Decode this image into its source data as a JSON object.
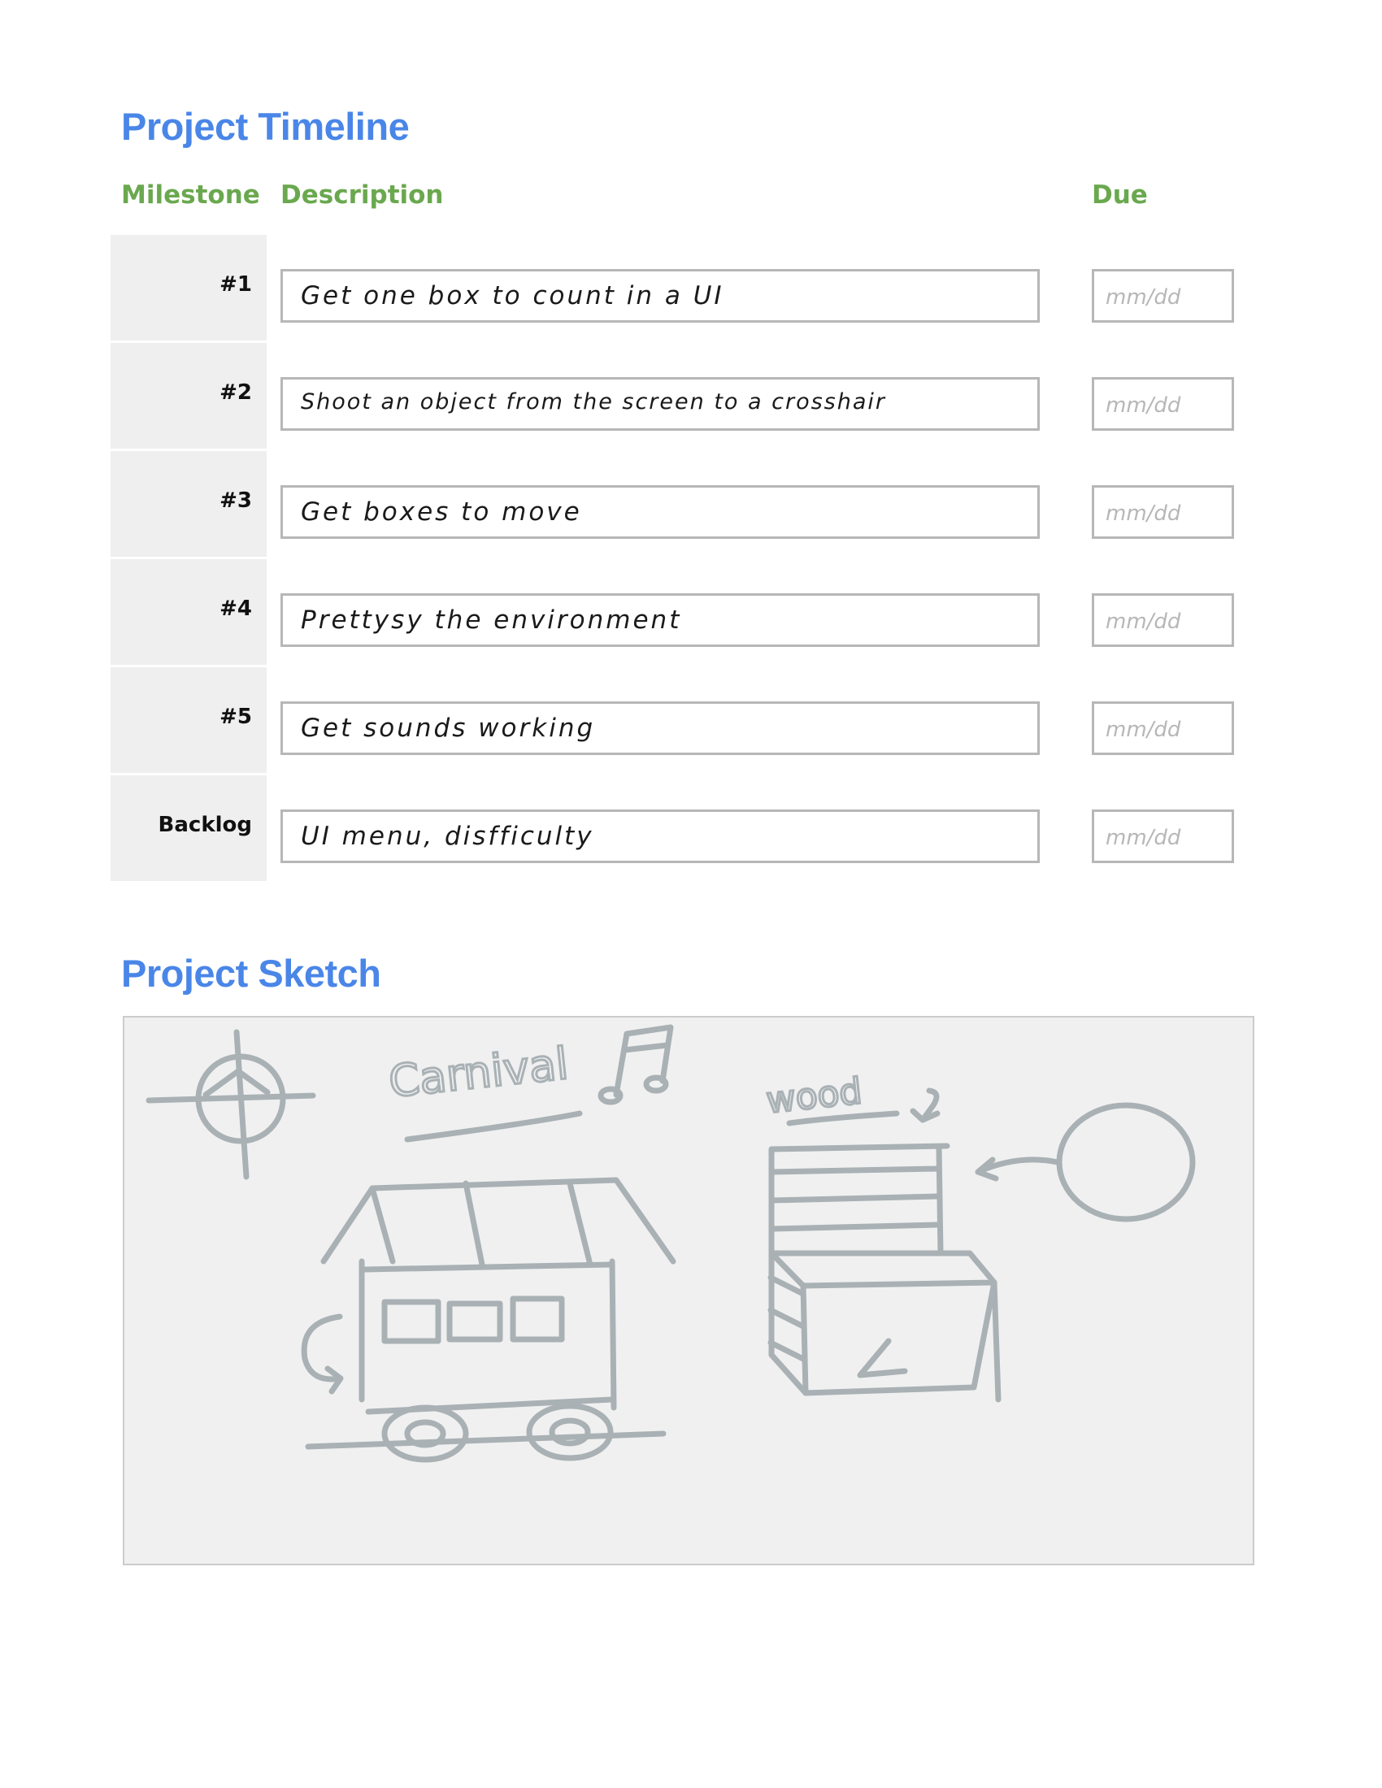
{
  "timeline": {
    "title": "Project Timeline",
    "headers": {
      "milestone": "Milestone",
      "description": "Description",
      "due": "Due"
    },
    "rows": [
      {
        "milestone": "#1",
        "description": "Get one box to count in a UI",
        "due_placeholder": "mm/dd"
      },
      {
        "milestone": "#2",
        "description": "Shoot an object from the screen to a crosshair",
        "due_placeholder": "mm/dd"
      },
      {
        "milestone": "#3",
        "description": "Get boxes to move",
        "due_placeholder": "mm/dd"
      },
      {
        "milestone": "#4",
        "description": "Prettysy the environment",
        "due_placeholder": "mm/dd"
      },
      {
        "milestone": "#5",
        "description": "Get sounds working",
        "due_placeholder": "mm/dd"
      },
      {
        "milestone": "Backlog",
        "description": "UI menu, disfficulty",
        "due_placeholder": "mm/dd"
      }
    ]
  },
  "sketch": {
    "title": "Project Sketch",
    "labels": {
      "carnival": "Carnival",
      "wood": "wood"
    },
    "colors": {
      "ink": "#a9b1b5",
      "panel": "#f0f0f0"
    }
  }
}
